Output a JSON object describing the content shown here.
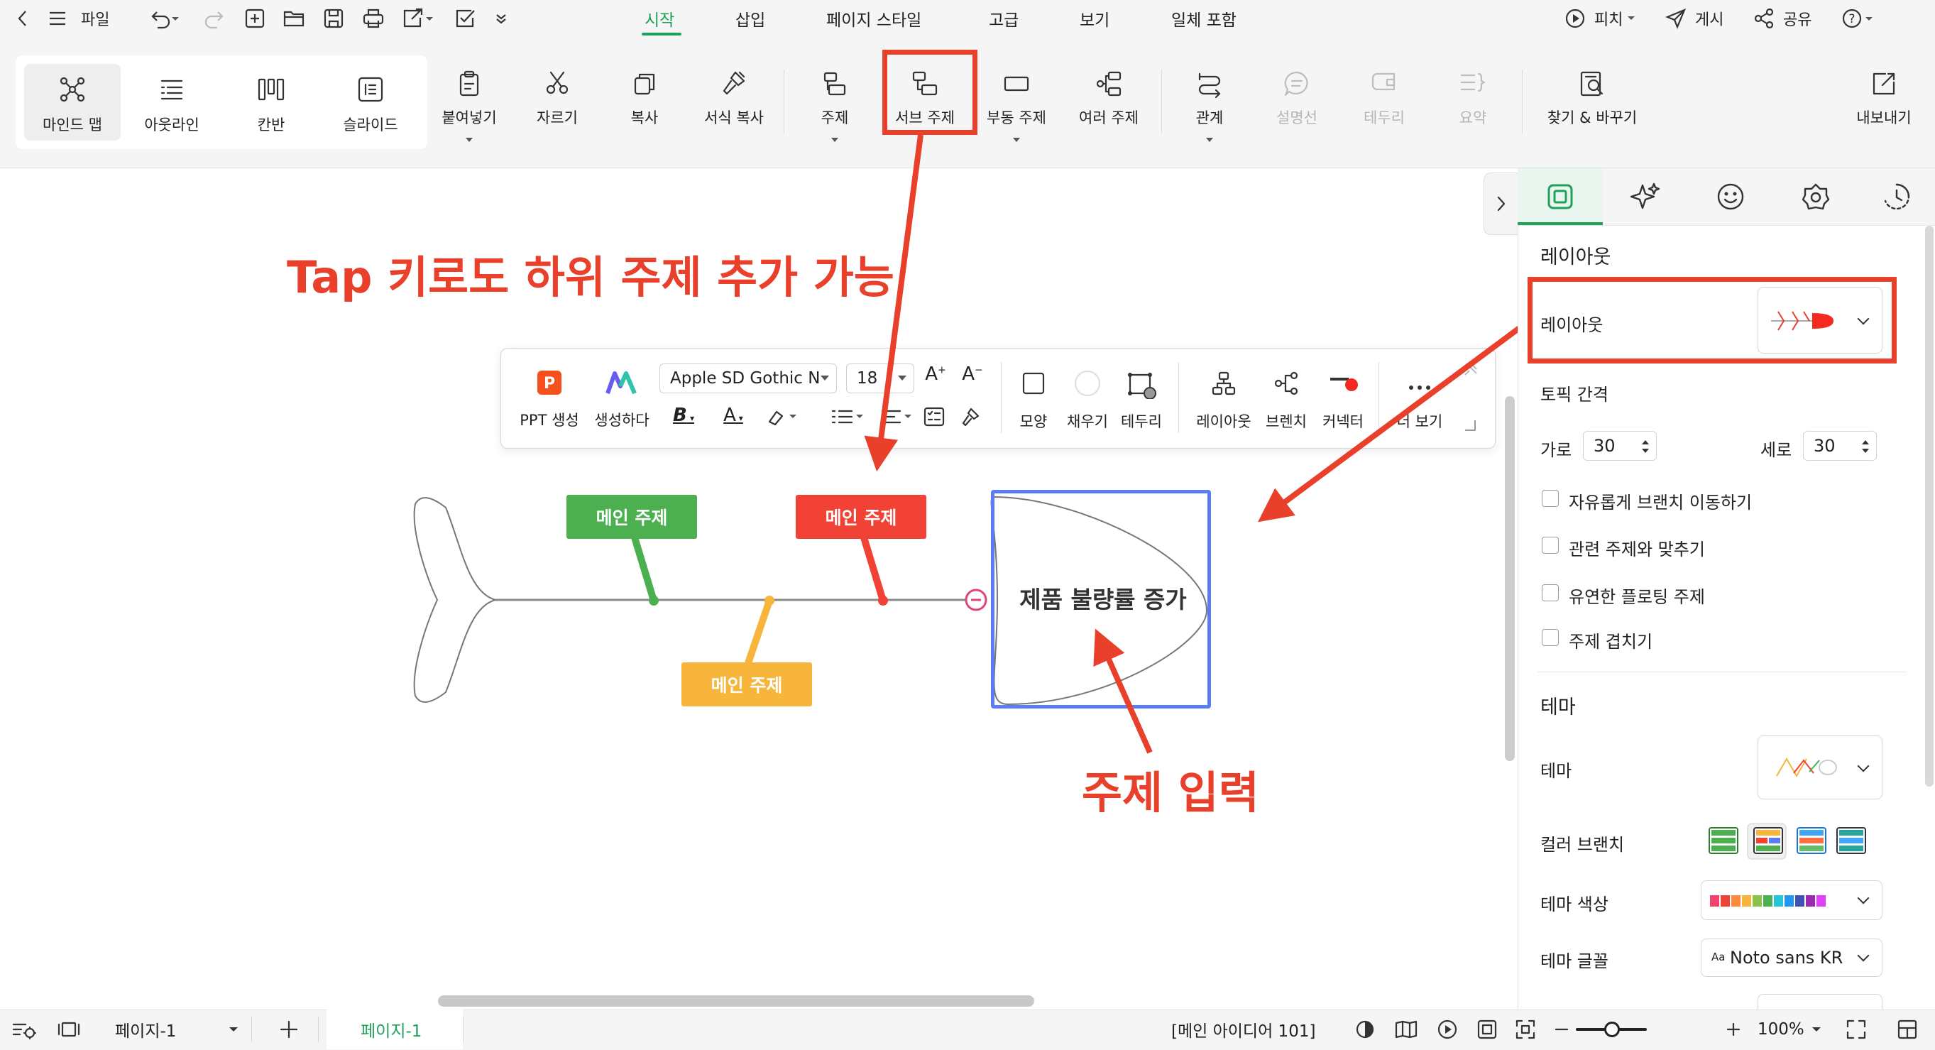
{
  "topbar": {
    "file_label": "파일",
    "menu_tabs": [
      "시작",
      "삽입",
      "페이지 스타일",
      "고급",
      "보기",
      "일체 포함"
    ],
    "present_label": "피치",
    "publish_label": "게시",
    "share_label": "공유"
  },
  "ribbon": {
    "views": [
      "마인드 맵",
      "아웃라인",
      "칸반",
      "슬라이드"
    ],
    "paste": "붙여넣기",
    "cut": "자르기",
    "copy": "복사",
    "format_painter": "서식 복사",
    "topic": "주제",
    "subtopic": "서브 주제",
    "floating_topic": "부동 주제",
    "multiple_topics": "여러 주제",
    "relation": "관계",
    "callout": "설명선",
    "boundary": "테두리",
    "summary": "요약",
    "find_replace": "찾기 & 바꾸기",
    "export": "내보내기"
  },
  "floating_toolbar": {
    "ppt": "PPT 생성",
    "generate": "생성하다",
    "font": "Apple SD Gothic N",
    "font_size": "18",
    "shape": "모양",
    "fill": "채우기",
    "border": "테두리",
    "layout": "레이아웃",
    "branch": "브렌치",
    "connector": "커넥터",
    "more": "더 보기"
  },
  "canvas": {
    "main_topic_green": "메인 주제",
    "main_topic_red": "메인 주제",
    "main_topic_yellow": "메인 주제",
    "central_topic": "제품 불량률 증가",
    "annotation_tab": "Tap 키로도 하위 주제 추가 가능",
    "annotation_input": "주제 입력"
  },
  "panel": {
    "layout_section": "레이아웃",
    "layout_label": "레이아웃",
    "topic_spacing": "토픽 간격",
    "horizontal_label": "가로",
    "horizontal_value": "30",
    "vertical_label": "세로",
    "vertical_value": "30",
    "checkboxes": [
      "자유롭게 브랜치 이동하기",
      "관련 주제와 맞추기",
      "유연한 플로팅 주제",
      "주제 겹치기"
    ],
    "theme_section": "테마",
    "theme_label": "테마",
    "color_branch_label": "컬러 브랜치",
    "theme_color_label": "테마 색상",
    "theme_font_label": "테마 글꼴",
    "theme_font_value": "Noto sans KR",
    "theme_font_prefix": "Aa"
  },
  "status": {
    "page_select": "페이지-1",
    "page_tab": "페이지-1",
    "word_count": "[메인 아이디어 101]",
    "zoom": "100%"
  },
  "colors": {
    "accent_green": "#21a05c",
    "topic_green": "#4caf50",
    "topic_red": "#f24236",
    "topic_yellow": "#f7b53b",
    "annotation_red": "#e8402a",
    "selection_blue": "#5b7cf5"
  }
}
